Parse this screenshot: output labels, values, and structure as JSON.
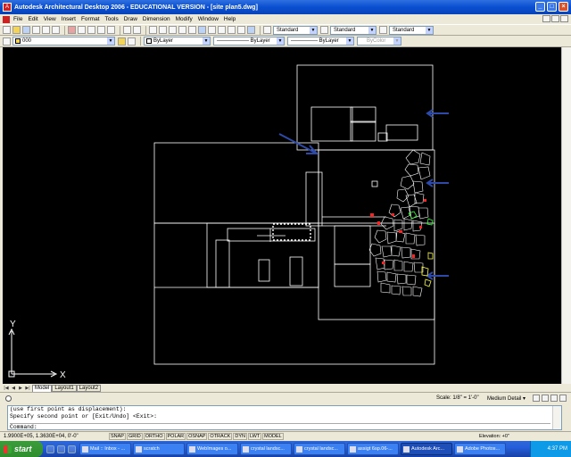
{
  "window": {
    "title": "Autodesk Architectural Desktop 2006 - EDUCATIONAL VERSION - [site plan5.dwg]",
    "controls": {
      "minimize": "_",
      "maximize": "□",
      "close": "×"
    }
  },
  "menu": [
    "File",
    "Edit",
    "View",
    "Insert",
    "Format",
    "Tools",
    "Draw",
    "Dimension",
    "Modify",
    "Window",
    "Help"
  ],
  "toolbar_styles": {
    "text_style": "Standard",
    "dim_style": "Standard",
    "table_style": "Standard"
  },
  "layers": {
    "current_layer": "000",
    "color": "ByLayer",
    "linetype": "ByLayer",
    "lineweight": "ByLayer",
    "plotstyle": "ByColor"
  },
  "tabs": [
    "Model",
    "Layout1",
    "Layout2"
  ],
  "tab_nav": [
    "|◀",
    "◀",
    "▶",
    "▶|"
  ],
  "drawing_status": {
    "scale": "Scale: 1/8\" = 1'-0\"",
    "detail": "Medium Detail ▾"
  },
  "command_history": [
    "(use first point as displacement):",
    "Specify second point or [Exit/Undo] <Exit>:"
  ],
  "command_prompt": "Command:",
  "ucs": {
    "x_label": "X",
    "y_label": "Y"
  },
  "status": {
    "coords": "1.9900E+05, 1.3630E+04, 0'-0\"",
    "toggles": [
      "SNAP",
      "GRID",
      "ORTHO",
      "POLAR",
      "OSNAP",
      "OTRACK",
      "DYN",
      "LWT",
      "MODEL"
    ],
    "elevation": "Elevation: +0\""
  },
  "taskbar": {
    "start": "start",
    "tasks": [
      "Mail :: Inbox - ...",
      "scratch",
      "WebImages o...",
      "crystal landsc...",
      "crystal landsc...",
      "assigt 6sp.06-...",
      "Autodesk Arc...",
      "Adobe Photos..."
    ],
    "active_index": 6,
    "time": "4:37 PM"
  },
  "colors": {
    "canvas_bg": "#000000",
    "line": "#ffffff",
    "arrow": "#2e4aa8",
    "accent_red": "#ff2020",
    "accent_green": "#33ff33",
    "accent_yellow": "#ffff40"
  }
}
